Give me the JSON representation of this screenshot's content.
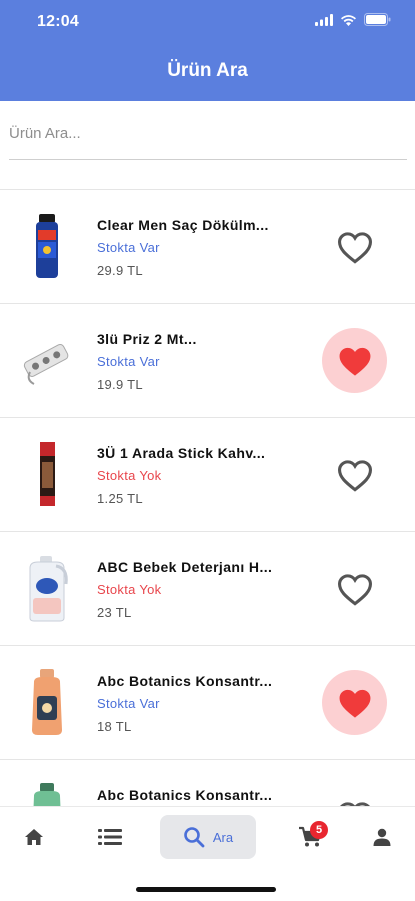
{
  "status_bar": {
    "time": "12:04"
  },
  "header": {
    "title": "Ürün Ara"
  },
  "search": {
    "placeholder": "Ürün Ara..."
  },
  "products": [
    {
      "name": " Clear Men Saç Dökülm...",
      "stock": "Stokta Var",
      "price": "29.9 TL",
      "favorite": false,
      "icon": "shampoo-bottle-icon"
    },
    {
      "name": "3lü Priz 2 Mt...",
      "stock": "Stokta Var",
      "price": "19.9 TL",
      "favorite": true,
      "icon": "power-strip-icon"
    },
    {
      "name": "3Ü 1 Arada Stick Kahv...",
      "stock": "Stokta Yok",
      "price": "1.25 TL",
      "favorite": false,
      "icon": "coffee-stick-icon"
    },
    {
      "name": "ABC Bebek Deterjanı H...",
      "stock": "Stokta Yok",
      "price": "23 TL",
      "favorite": false,
      "icon": "detergent-bottle-icon"
    },
    {
      "name": "Abc Botanics Konsantr...",
      "stock": "Stokta Var",
      "price": "18 TL",
      "favorite": true,
      "icon": "softener-bottle-icon"
    },
    {
      "name": "Abc Botanics Konsantr...",
      "stock": "",
      "price": "",
      "favorite": false,
      "icon": "softener-bottle-icon"
    }
  ],
  "tabbar": {
    "search_label": "Ara",
    "cart_badge": "5",
    "tabs": [
      "home-icon",
      "list-icon",
      "search-icon",
      "cart-icon",
      "user-icon"
    ]
  },
  "colors": {
    "header": "#5b7fde",
    "in_stock": "#4a6fd8",
    "out_of_stock": "#e8464c",
    "favorite_fill": "#f03b3b",
    "favorite_bg": "#fcd0d2"
  }
}
